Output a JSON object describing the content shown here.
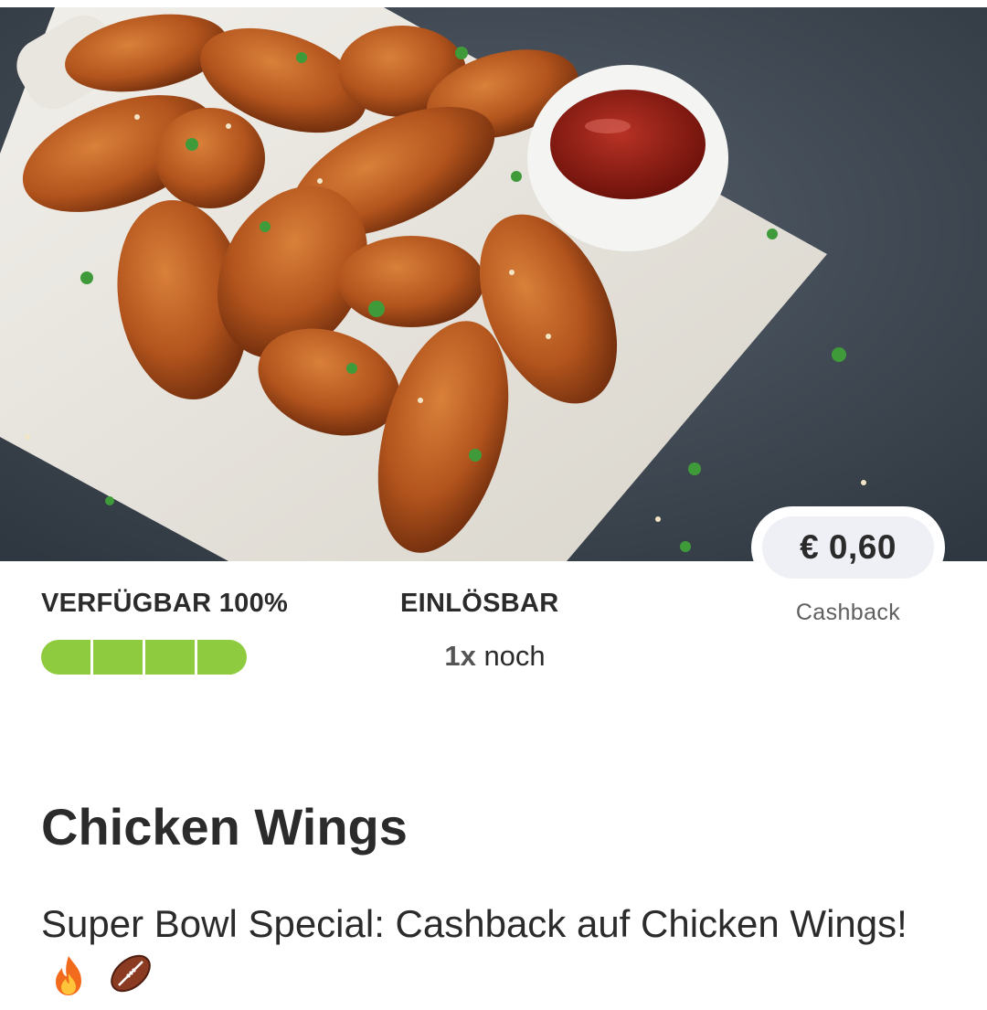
{
  "hero": {
    "image_icon": "chicken-wings-photo",
    "colors": {
      "background": "#39424d",
      "board": "#e6e3dc",
      "wings": "#b2541d",
      "sauce": "#8c1a12"
    }
  },
  "cashback": {
    "amount": "€ 0,60",
    "label": "Cashback"
  },
  "availability": {
    "title": "VERFÜGBAR 100%",
    "percent": 100,
    "segments": 4,
    "bar_color": "#8fcb3e"
  },
  "redeemable": {
    "title": "EINLÖSBAR",
    "count": "1x",
    "suffix": "noch"
  },
  "product": {
    "title": "Chicken Wings",
    "description": "Super Bowl Special: Cashback auf Chicken Wings!",
    "emojis": [
      "fire-icon",
      "football-icon"
    ]
  }
}
